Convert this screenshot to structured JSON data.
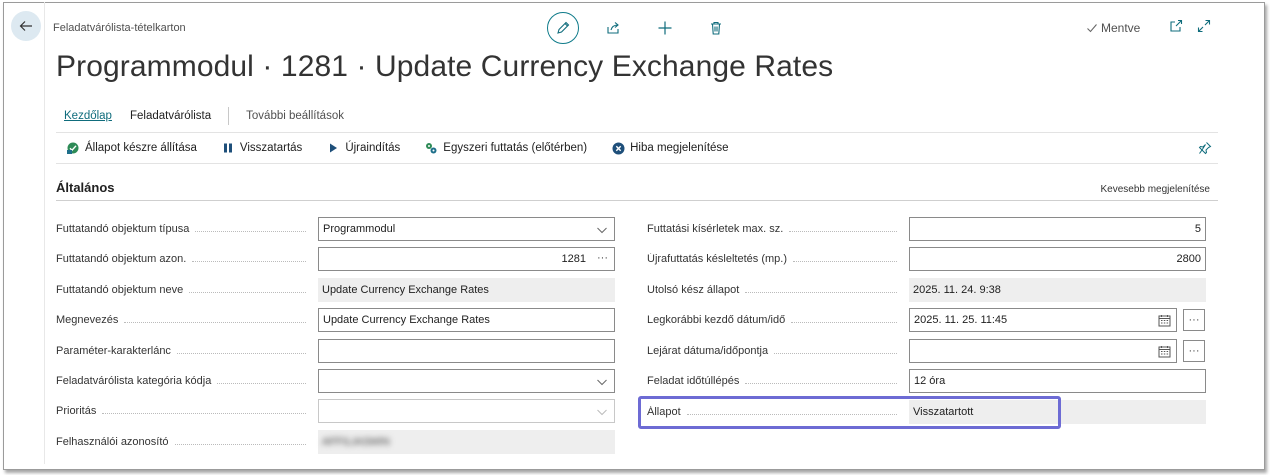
{
  "header": {
    "page_type": "Feladatvárólista-tételkarton",
    "saved_label": "Mentve",
    "title": "Programmodul · 1281 · Update Currency Exchange Rates"
  },
  "tabs": [
    {
      "label": "Kezdőlap"
    },
    {
      "label": "Feladatvárólista"
    },
    {
      "label": "További beállítások"
    }
  ],
  "actions": [
    {
      "label": "Állapot készre állítása"
    },
    {
      "label": "Visszatartás"
    },
    {
      "label": "Újraindítás"
    },
    {
      "label": "Egyszeri futtatás (előtérben)"
    },
    {
      "label": "Hiba megjelenítése"
    }
  ],
  "section": {
    "title": "Általános",
    "show_less": "Kevesebb megjelenítése"
  },
  "left_fields": [
    {
      "label": "Futtatandó objektum típusa",
      "value": "Programmodul"
    },
    {
      "label": "Futtatandó objektum azon.",
      "value": "1281",
      "ellipsis": "···"
    },
    {
      "label": "Futtatandó objektum neve",
      "value": "Update Currency Exchange Rates"
    },
    {
      "label": "Megnevezés",
      "value": "Update Currency Exchange Rates"
    },
    {
      "label": "Paraméter-karakterlánc",
      "value": ""
    },
    {
      "label": "Feladatvárólista kategória kódja",
      "value": ""
    },
    {
      "label": "Prioritás",
      "value": ""
    },
    {
      "label": "Felhasználói azonosító",
      "value": "AFFILIASMIN"
    }
  ],
  "right_fields": [
    {
      "label": "Futtatási kísérletek max. sz.",
      "value": "5"
    },
    {
      "label": "Újrafuttatás késleltetés (mp.)",
      "value": "2800"
    },
    {
      "label": "Utolsó kész állapot",
      "value": "2025. 11. 24. 9:38"
    },
    {
      "label": "Legkorábbi kezdő dátum/idő",
      "value": "2025. 11. 25. 11:45",
      "ellipsis": "···"
    },
    {
      "label": "Lejárat dátuma/időpontja",
      "value": "",
      "ellipsis": "···"
    },
    {
      "label": "Feladat időtúllépés",
      "value": "12 óra"
    },
    {
      "label": "Állapot",
      "value": "Visszatartott"
    }
  ],
  "colors": {
    "accent": "#0f6c7c",
    "highlight": "#6d6bd4",
    "readonly_bg": "#eeeeee"
  }
}
